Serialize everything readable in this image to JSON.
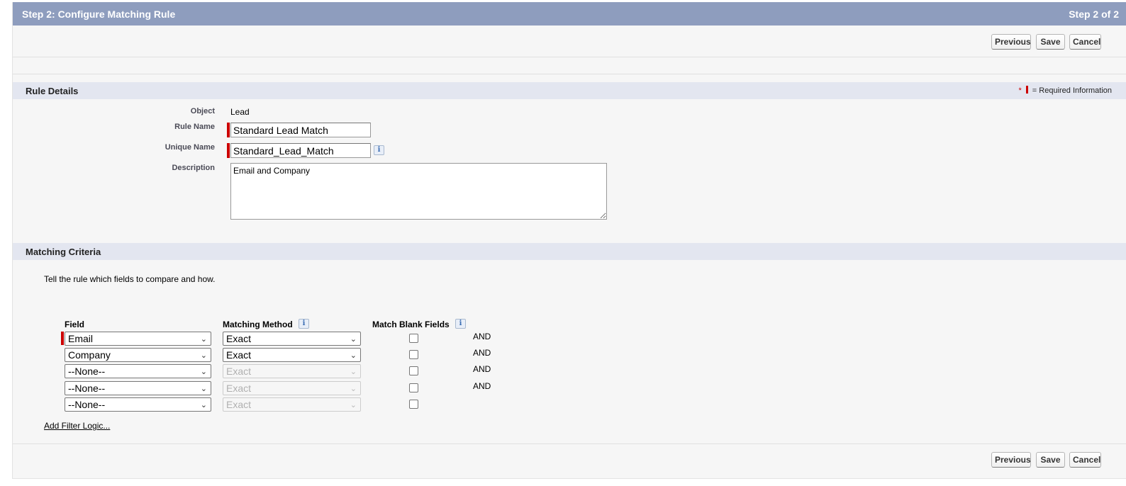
{
  "header": {
    "title": "Step 2: Configure Matching Rule",
    "step": "Step 2 of 2"
  },
  "buttons": {
    "previous": "Previous",
    "save": "Save",
    "cancel": "Cancel"
  },
  "rule_details": {
    "heading": "Rule Details",
    "required_star": "*",
    "required_text": "= Required Information",
    "object_label": "Object",
    "object_value": "Lead",
    "rule_name_label": "Rule Name",
    "rule_name_value": "Standard Lead Match",
    "unique_name_label": "Unique Name",
    "unique_name_value": "Standard_Lead_Match",
    "description_label": "Description",
    "description_value": "Email and Company"
  },
  "matching_criteria": {
    "heading": "Matching Criteria",
    "intro": "Tell the rule which fields to compare and how.",
    "columns": {
      "field": "Field",
      "method": "Matching Method",
      "blank": "Match Blank Fields"
    },
    "rows": [
      {
        "field": "Email",
        "method": "Exact",
        "method_enabled": true,
        "match_blank": false,
        "connector": "AND",
        "required": true
      },
      {
        "field": "Company",
        "method": "Exact",
        "method_enabled": true,
        "match_blank": false,
        "connector": "AND",
        "required": false
      },
      {
        "field": "--None--",
        "method": "Exact",
        "method_enabled": false,
        "match_blank": false,
        "connector": "AND",
        "required": false
      },
      {
        "field": "--None--",
        "method": "Exact",
        "method_enabled": false,
        "match_blank": false,
        "connector": "AND",
        "required": false
      },
      {
        "field": "--None--",
        "method": "Exact",
        "method_enabled": false,
        "match_blank": false,
        "connector": "",
        "required": false
      }
    ],
    "add_filter_logic": "Add Filter Logic..."
  },
  "icons": {
    "info": "info-icon",
    "dropdown": "chevron-down-icon"
  },
  "colors": {
    "header_bg": "#8e9dbe",
    "section_bg": "#e3e6f0",
    "required": "#cc0000"
  }
}
